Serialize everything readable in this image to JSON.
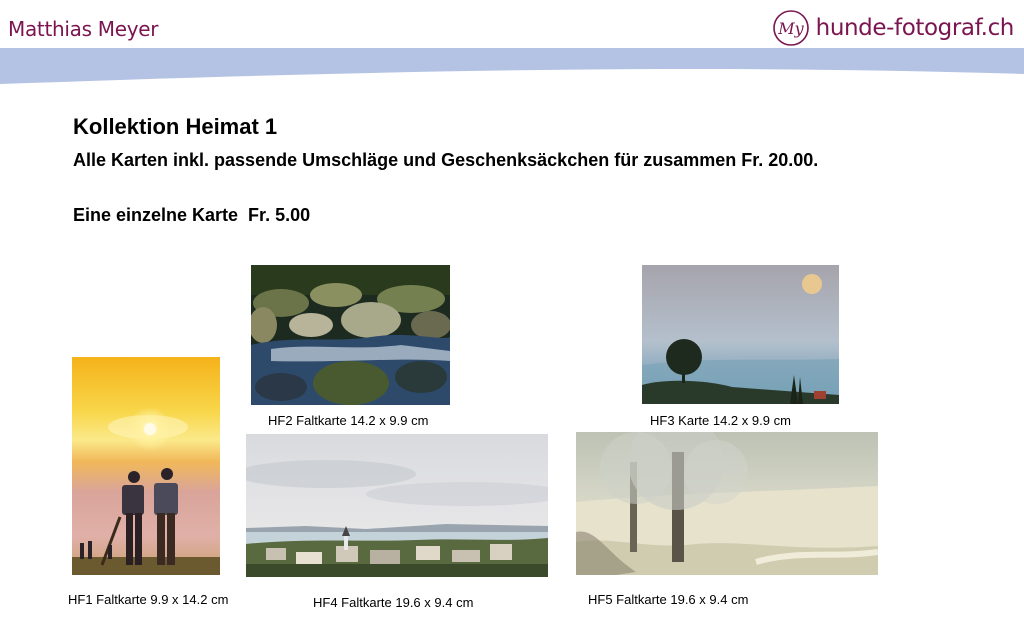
{
  "header": {
    "author": "Matthias Meyer",
    "brand_mark": "My",
    "brand_site": "hunde-fotograf.ch"
  },
  "content": {
    "title": "Kollektion Heimat 1",
    "subtitle": "Alle Karten inkl. passende Umschläge und Geschenksäckchen für zusammen Fr. 20.00.",
    "single_price": "Eine einzelne Karte  Fr. 5.00"
  },
  "cards": [
    {
      "id": "HF1",
      "caption": "HF1 Faltkarte 9.9 x 14.2 cm",
      "subject": "sunset-alphorn-players"
    },
    {
      "id": "HF2",
      "caption": "HF2 Faltkarte 14.2 x 9.9 cm",
      "subject": "mountain-stream-rocks"
    },
    {
      "id": "HF3",
      "caption": "HF3 Karte 14.2 x 9.9 cm",
      "subject": "tree-moon-dusk"
    },
    {
      "id": "HF4",
      "caption": "HF4 Faltkarte 19.6 x 9.4 cm",
      "subject": "village-lake-panorama"
    },
    {
      "id": "HF5",
      "caption": "HF5 Faltkarte 19.6 x 9.4 cm",
      "subject": "frosty-trees-meadow"
    }
  ],
  "colors": {
    "brand": "#7a1550",
    "swoosh": "#b4c3e4"
  }
}
